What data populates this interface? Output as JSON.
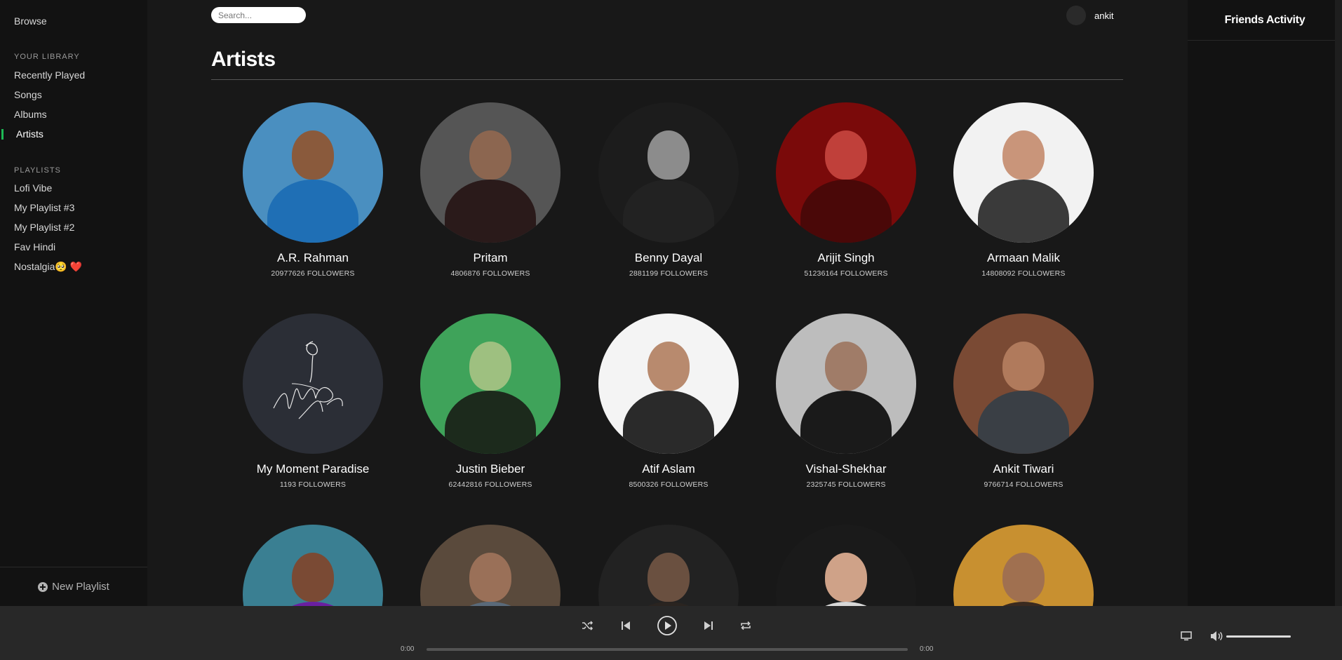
{
  "sidebar": {
    "browse": "Browse",
    "library_title": "YOUR LIBRARY",
    "library": [
      "Recently Played",
      "Songs",
      "Albums",
      "Artists"
    ],
    "playlists_title": "PLAYLISTS",
    "playlists": [
      "Lofi Vibe",
      "My Playlist #3",
      "My Playlist #2",
      "Fav Hindi",
      "Nostalgia🥺 ❤️"
    ],
    "new_playlist": "New Playlist"
  },
  "header": {
    "search_placeholder": "Search...",
    "username": "ankit"
  },
  "page_title": "Artists",
  "artists": [
    {
      "name": "A.R. Rahman",
      "followers": "20977626 FOLLOWERS",
      "bg": "#4a8fc0",
      "skin": "#8a5a3c",
      "shirt": "#1f6fb5"
    },
    {
      "name": "Pritam",
      "followers": "4806876 FOLLOWERS",
      "bg": "#555555",
      "skin": "#8c6650",
      "shirt": "#2a1a1a"
    },
    {
      "name": "Benny Dayal",
      "followers": "2881199 FOLLOWERS",
      "bg": "#1c1c1c",
      "skin": "#8c8c8c",
      "shirt": "#222222"
    },
    {
      "name": "Arijit Singh",
      "followers": "51236164 FOLLOWERS",
      "bg": "#7a0a0a",
      "skin": "#c0403a",
      "shirt": "#4a0808"
    },
    {
      "name": "Armaan Malik",
      "followers": "14808092 FOLLOWERS",
      "bg": "#f2f2f2",
      "skin": "#c9957a",
      "shirt": "#3a3a3a"
    },
    {
      "name": "My Moment Paradise",
      "followers": "1193 FOLLOWERS",
      "bg": "#2b2e36",
      "skin": "#2b2e36",
      "shirt": "#2b2e36"
    },
    {
      "name": "Justin Bieber",
      "followers": "62442816 FOLLOWERS",
      "bg": "#3fa35a",
      "skin": "#9ec080",
      "shirt": "#1c2a1c"
    },
    {
      "name": "Atif Aslam",
      "followers": "8500326 FOLLOWERS",
      "bg": "#f4f4f4",
      "skin": "#b88a6e",
      "shirt": "#2a2a2a"
    },
    {
      "name": "Vishal-Shekhar",
      "followers": "2325745 FOLLOWERS",
      "bg": "#bdbdbd",
      "skin": "#a07c68",
      "shirt": "#1a1a1a"
    },
    {
      "name": "Ankit Tiwari",
      "followers": "9766714 FOLLOWERS",
      "bg": "#7a4a34",
      "skin": "#b07a5c",
      "shirt": "#3a3f45"
    },
    {
      "name": "",
      "followers": "",
      "bg": "#3a7f92",
      "skin": "#7a4a34",
      "shirt": "#6a1fa0"
    },
    {
      "name": "",
      "followers": "",
      "bg": "#5a4a3c",
      "skin": "#9a7058",
      "shirt": "#5a6a7a"
    },
    {
      "name": "",
      "followers": "",
      "bg": "#222222",
      "skin": "#6a5040",
      "shirt": "#2a2420"
    },
    {
      "name": "",
      "followers": "",
      "bg": "#1a1a1a",
      "skin": "#cfa288",
      "shirt": "#d8d8d8"
    },
    {
      "name": "",
      "followers": "",
      "bg": "#c89030",
      "skin": "#a07050",
      "shirt": "#3a2a20"
    }
  ],
  "right_panel": {
    "title": "Friends Activity"
  },
  "player": {
    "time_current": "0:00",
    "time_total": "0:00",
    "progress": 0.0,
    "volume": 1.0,
    "icons": [
      "shuffle-icon",
      "previous-icon",
      "play-icon",
      "next-icon",
      "repeat-icon",
      "device-icon",
      "volume-icon"
    ]
  }
}
